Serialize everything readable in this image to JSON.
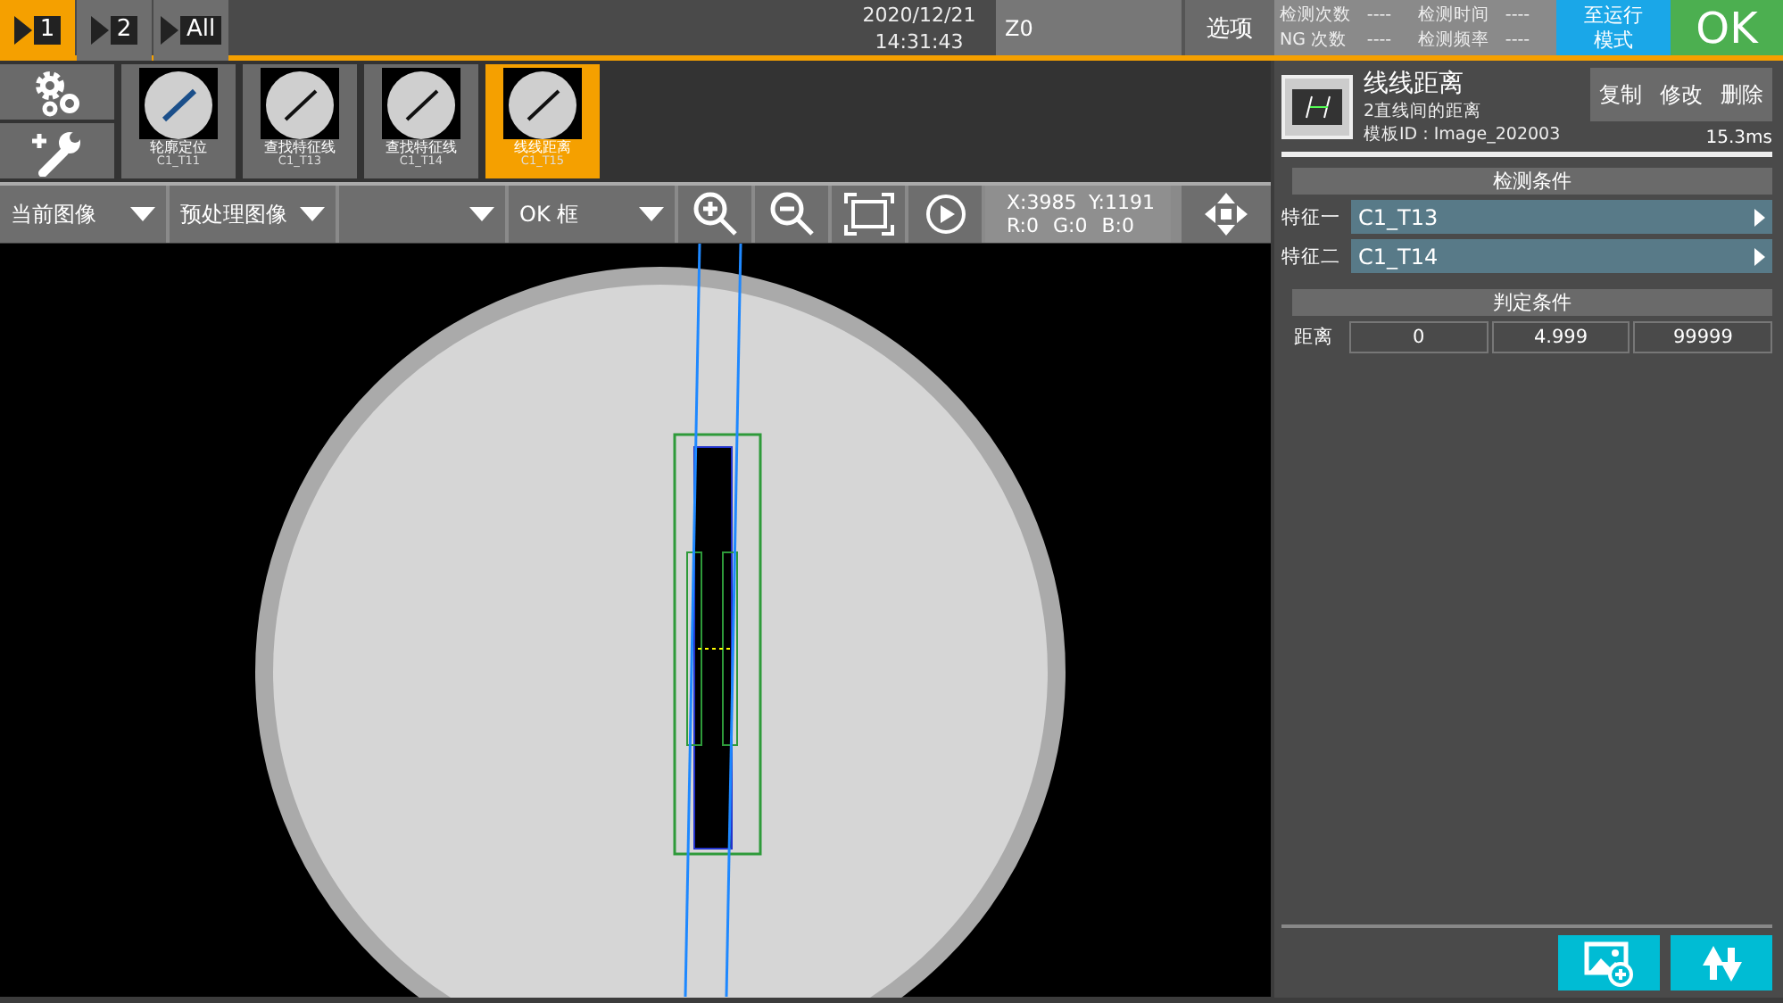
{
  "camera_tabs": [
    {
      "label": "1",
      "selected": true
    },
    {
      "label": "2",
      "selected": false
    },
    {
      "label": "All",
      "selected": false
    }
  ],
  "datetime": {
    "date": "2020/12/21",
    "time": "14:31:43"
  },
  "zone_field": {
    "value": "Z0"
  },
  "options_button": "选项",
  "stats": [
    {
      "label": "检测次数",
      "value": "----"
    },
    {
      "label": "检测时间",
      "value": "----"
    },
    {
      "label": "NG 次数",
      "value": "----"
    },
    {
      "label": "检测频率",
      "value": "----"
    }
  ],
  "mode_button": [
    "至运行",
    "模式"
  ],
  "result": {
    "label": "OK"
  },
  "tools": [
    {
      "label": "轮廓定位",
      "id_label": "C1_T11",
      "selected": false
    },
    {
      "label": "查找特征线",
      "id_label": "C1_T13",
      "selected": false
    },
    {
      "label": "查找特征线",
      "id_label": "C1_T14",
      "selected": false
    },
    {
      "label": "线线距离",
      "id_label": "C1_T15",
      "selected": true
    }
  ],
  "toolbar": {
    "dropdowns": [
      {
        "kind": "labeled",
        "label": "当前图像"
      },
      {
        "kind": "labeled",
        "label": "预处理图像"
      },
      {
        "kind": "blank"
      },
      {
        "kind": "labeled",
        "label": "OK 框"
      }
    ],
    "coords": {
      "x": "X:3985",
      "y": "Y:1191",
      "r": "R:0",
      "g": "G:0",
      "b": "B:0"
    }
  },
  "tool_detail": {
    "title": "线线距离",
    "subtitle": "2直线间的距离",
    "template_id": "模板ID : Image_202003",
    "time": "15.3ms",
    "actions": [
      "复制",
      "修改",
      "删除"
    ]
  },
  "detection_conditions": {
    "title": "检测条件",
    "features": [
      {
        "label": "特征一",
        "value": "C1_T13"
      },
      {
        "label": "特征二",
        "value": "C1_T14"
      }
    ]
  },
  "judgment_conditions": {
    "title": "判定条件",
    "rows": [
      {
        "label": "距离",
        "values": [
          "0",
          "4.999",
          "99999"
        ]
      }
    ]
  }
}
